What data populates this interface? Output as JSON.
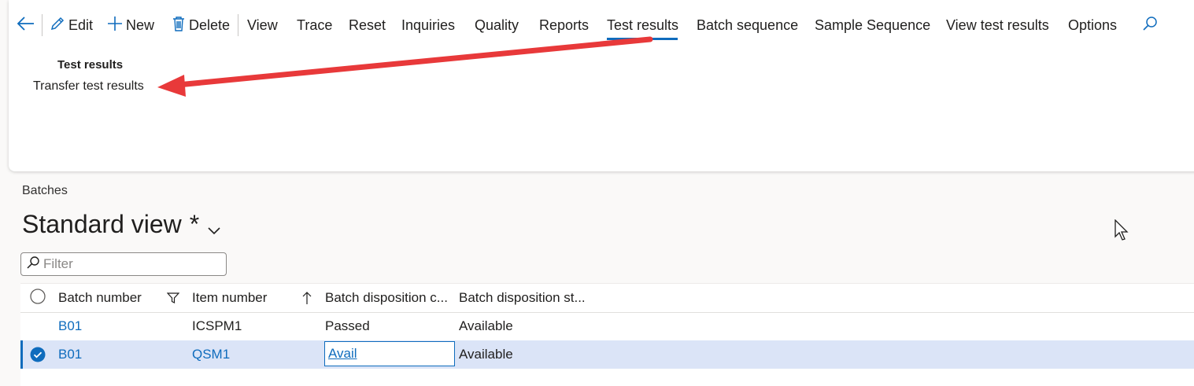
{
  "toolbar": {
    "back_label": "",
    "edit": "Edit",
    "new": "New",
    "delete": "Delete",
    "view": "View",
    "trace": "Trace",
    "reset": "Reset",
    "inquiries": "Inquiries",
    "quality": "Quality",
    "reports": "Reports",
    "test_results": "Test results",
    "batch_sequence": "Batch sequence",
    "sample_sequence": "Sample Sequence",
    "view_test_results": "View test results",
    "options": "Options",
    "active_tab": "Test results"
  },
  "dropdown": {
    "group_title": "Test results",
    "items": [
      "Transfer test results"
    ]
  },
  "page": {
    "caption": "Batches",
    "view_name": "Standard view",
    "modified_marker": "*"
  },
  "filter": {
    "placeholder": "Filter",
    "value": ""
  },
  "grid": {
    "columns": [
      "Batch number",
      "Item number",
      "Batch disposition c...",
      "Batch disposition st..."
    ],
    "rows": [
      {
        "batch": "B01",
        "item": "ICSPM1",
        "disposition_code": "Passed",
        "disposition_status": "Available",
        "selected": false
      },
      {
        "batch": "B01",
        "item": "QSM1",
        "disposition_code": "Avail",
        "disposition_status": "Available",
        "selected": true
      }
    ]
  },
  "colors": {
    "accent": "#0f6cbd",
    "selected_row": "#dbe4f7",
    "annotation_arrow": "#e8393a"
  },
  "icons": [
    "back-arrow-icon",
    "edit-pencil-icon",
    "plus-icon",
    "trash-icon",
    "search-icon",
    "chevron-down-icon",
    "filter-icon",
    "sort-up-icon",
    "radio-circle-icon",
    "check-circle-icon",
    "mouse-cursor-icon"
  ]
}
